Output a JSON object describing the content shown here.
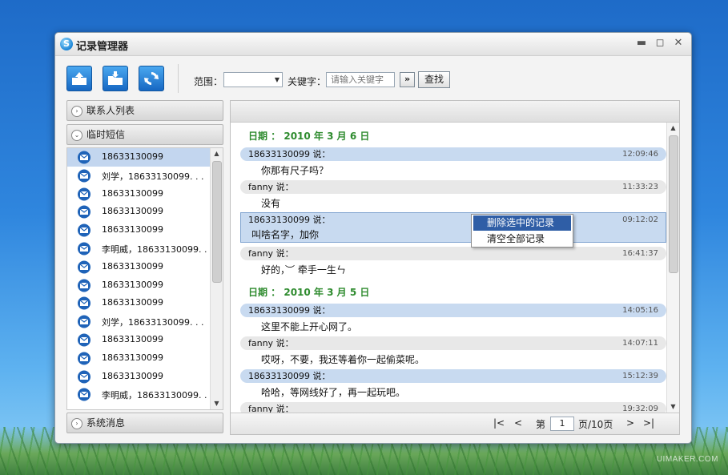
{
  "window": {
    "title": "记录管理器",
    "minimize": "▬",
    "maximize": "◻",
    "close": "✕"
  },
  "toolbar": {
    "range_label": "范围：",
    "range_value": "",
    "keyword_label": "关键字：",
    "keyword_placeholder": "请输入关键字",
    "go_label": "»",
    "search_label": "查找"
  },
  "sidebar": {
    "contacts_header": "联系人列表",
    "temp_sms_header": "临时短信",
    "system_header": "系统消息",
    "items": [
      {
        "label": "18633130099",
        "selected": true
      },
      {
        "label": "刘学，18633130099. . ."
      },
      {
        "label": "18633130099"
      },
      {
        "label": "18633130099"
      },
      {
        "label": "18633130099"
      },
      {
        "label": "李明威，18633130099. . ."
      },
      {
        "label": "18633130099"
      },
      {
        "label": "18633130099"
      },
      {
        "label": "18633130099"
      },
      {
        "label": "刘学，18633130099. . ."
      },
      {
        "label": "18633130099"
      },
      {
        "label": "18633130099"
      },
      {
        "label": "18633130099"
      },
      {
        "label": "李明威，18633130099. . ."
      }
    ]
  },
  "messages": {
    "groups": [
      {
        "date": "日期 ： 2010 年 3 月 6 日",
        "entries": [
          {
            "speaker": "18633130099 说：",
            "time": "12:09:46",
            "text": "你那有尺子吗？",
            "style": "blue"
          },
          {
            "speaker": "fanny 说：",
            "time": "11:33:23",
            "text": "没有",
            "style": "grey"
          },
          {
            "speaker": "18633130099 说：",
            "time": "09:12:02",
            "text": "叫啥名字，加你",
            "style": "selected"
          },
          {
            "speaker": "fanny 说：",
            "time": "16:41:37",
            "text": "好的，︶ 牵手一生ㄣ",
            "style": "grey"
          }
        ]
      },
      {
        "date": "日期 ： 2010 年 3 月 5 日",
        "entries": [
          {
            "speaker": "18633130099 说：",
            "time": "14:05:16",
            "text": "这里不能上开心网了。",
            "style": "blue"
          },
          {
            "speaker": "fanny 说：",
            "time": "14:07:11",
            "text": "哎呀，不要，我还等着你一起偷菜呢。",
            "style": "grey"
          },
          {
            "speaker": "18633130099 说：",
            "time": "15:12:39",
            "text": "哈哈，等网线好了，再一起玩吧。",
            "style": "blue"
          },
          {
            "speaker": "fanny 说：",
            "time": "19:32:09",
            "text": "",
            "style": "grey"
          }
        ]
      }
    ]
  },
  "context_menu": {
    "items": [
      "删除选中的记录",
      "清空全部记录"
    ]
  },
  "pager": {
    "first": "|<",
    "prev": "<",
    "page_label": "第",
    "page_value": "1",
    "total": "页/10页",
    "next": ">",
    "last": ">|"
  },
  "watermark": "UIMAKER.COM",
  "colors": {
    "accent": "#2f5ea6",
    "date_green": "#2e8b2e",
    "bubble_blue": "#c8daf0",
    "bubble_grey": "#e8e8e8"
  }
}
